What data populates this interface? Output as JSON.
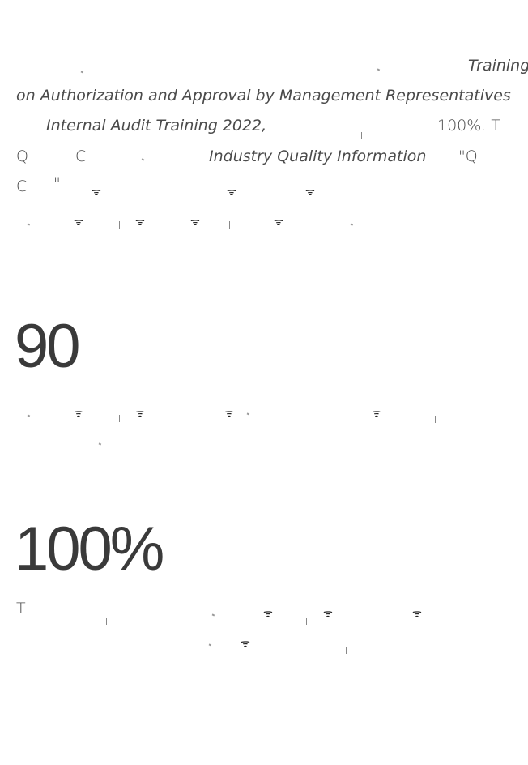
{
  "paragraph1": {
    "segments": {
      "training": "Training",
      "course_title": "on Authorization and Approval by Management Representatives",
      "audit_training": "Internal Audit Training 2022,",
      "percent": "100%. T",
      "q": "Q",
      "c": "C",
      "info_title": "Industry Quality Information",
      "quote_q": "\"Q",
      "c2": "C",
      "quote_mark": "\""
    }
  },
  "stat1": {
    "value": "90"
  },
  "stat2": {
    "value": "100%",
    "text_start": "T"
  },
  "icons": {
    "broken_glyph": "missing-glyph-icon"
  }
}
